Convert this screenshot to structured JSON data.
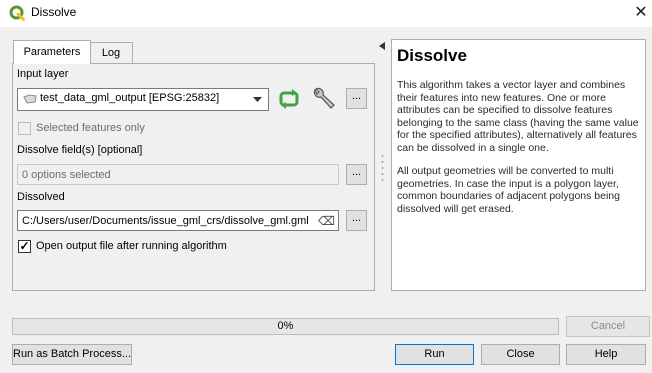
{
  "window": {
    "title": "Dissolve",
    "close_glyph": "✕"
  },
  "tabs": [
    {
      "label": "Parameters",
      "active": true
    },
    {
      "label": "Log",
      "active": false
    }
  ],
  "params": {
    "input_layer_label": "Input layer",
    "input_layer_value": "test_data_gml_output [EPSG:25832]",
    "dots": "...",
    "selected_only_label": "Selected features only",
    "selected_only_checked": false,
    "dissolve_fields_label": "Dissolve field(s) [optional]",
    "dissolve_fields_value": "0 options selected",
    "dissolved_label": "Dissolved",
    "dissolved_value": "C:/Users/user/Documents/issue_gml_crs/dissolve_gml.gml",
    "open_output_label": "Open output file after running algorithm",
    "open_output_checked": true,
    "check_glyph": "✓",
    "clear_glyph": "⌫"
  },
  "help": {
    "title": "Dissolve",
    "p1": "This algorithm takes a vector layer and combines their features into new features. One or more attributes can be specified to dissolve features belonging to the same class (having the same value for the specified attributes), alternatively all features can be dissolved in a single one.",
    "p2": "All output geometries will be converted to multi geometries. In case the input is a polygon layer, common boundaries of adjacent polygons being dissolved will get erased."
  },
  "progress": {
    "text": "0%",
    "value": 0
  },
  "buttons": {
    "cancel": "Cancel",
    "batch": "Run as Batch Process...",
    "run": "Run",
    "close": "Close",
    "help": "Help"
  },
  "colors": {
    "qgis_green": "#589632",
    "qgis_yellow": "#f0c419",
    "refresh_green": "#3ea343"
  }
}
